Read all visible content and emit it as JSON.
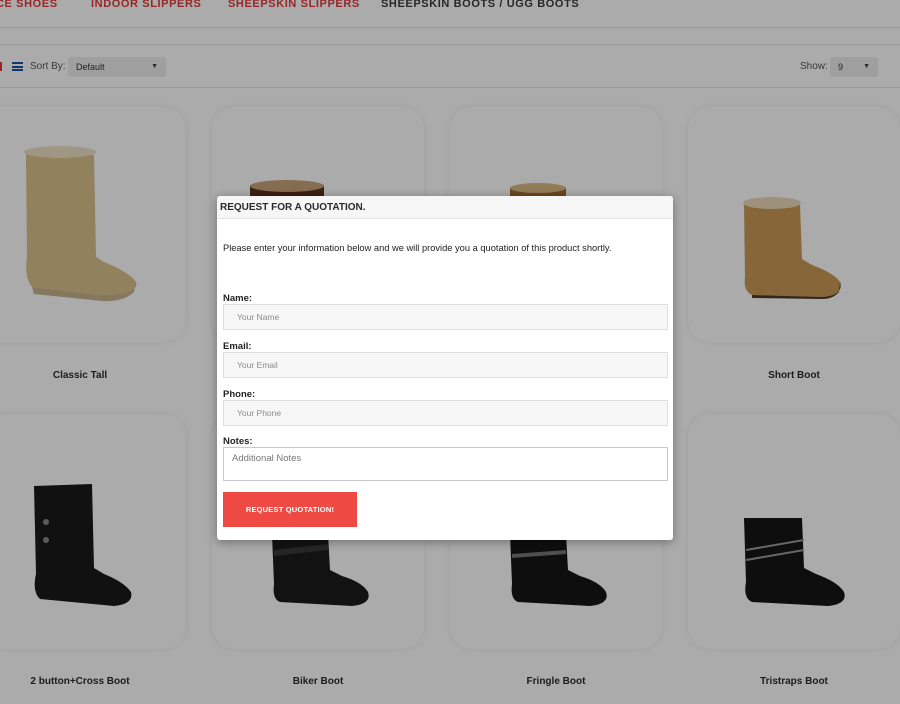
{
  "nav": {
    "items": [
      "CE SHOES",
      "INDOOR SLIPPERS",
      "SHEEPSKIN SLIPPERS",
      "SHEEPSKIN BOOTS / UGG BOOTS"
    ]
  },
  "toolbar": {
    "sort_label": "Sort By:",
    "sort_value": "Default",
    "show_label": "Show:",
    "show_value": "9"
  },
  "products": [
    "Classic Tall",
    "Short Boot",
    "2 button+Cross Boot",
    "Biker Boot",
    "Fringle Boot",
    "Tristraps Boot"
  ],
  "modal": {
    "title": "REQUEST FOR A QUOTATION.",
    "intro": "Please enter your information below and we will provide you a quotation of this product shortly.",
    "name_label": "Name:",
    "name_placeholder": "Your Name",
    "email_label": "Email:",
    "email_placeholder": "Your Email",
    "phone_label": "Phone:",
    "phone_placeholder": "Your Phone",
    "notes_label": "Notes:",
    "notes_placeholder": "Additional Notes",
    "submit_label": "REQUEST QUOTATION!"
  },
  "colors": {
    "accent_red": "#e43a3a",
    "button_red": "#ee4a43",
    "list_icon_blue": "#1f4fa8"
  },
  "icons": {
    "grid_view": "grid-view-icon",
    "list_view": "list-view-icon",
    "dropdown": "chevron-down-icon"
  }
}
